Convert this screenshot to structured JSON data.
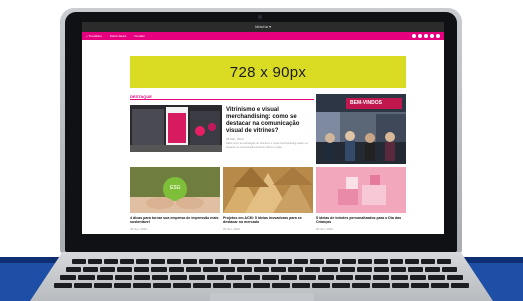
{
  "browser": {
    "title": "Idfacha  ▾"
  },
  "nav": {
    "links": [
      "+ TrendHire",
      "Sobre fatura",
      "Contato"
    ]
  },
  "banner": {
    "text": "728 x 90px"
  },
  "section": {
    "tag": "DESTAQUE"
  },
  "featured": {
    "title": "Vitrinismo e visual merchandising: como se destacar na comunicação visual de vitrines?",
    "date": "08 Mar, 2022",
    "excerpt": "Saiba como as estratégias de vitrinismo e visual merchandising podem se destacar na comunicação visual de vitrines e lojas."
  },
  "event_sign": "BEM-VINDOS",
  "articles": [
    {
      "title": "4 dicas para tornar sua empresa de impressão mais sustentável",
      "date": "30 Set, 2022",
      "thumb_text": "ESG"
    },
    {
      "title": "Projetos em ACM: 5 ideias inovadoras para se destacar no mercado",
      "date": "09 Set, 2022"
    },
    {
      "title": "5 ideias de brindes personalizados para o Dia das Crianças",
      "date": "09 Set, 2022"
    }
  ],
  "colors": {
    "brand": "#e6007e",
    "banner": "#d9dc22",
    "floor": "#1e4fa6"
  }
}
